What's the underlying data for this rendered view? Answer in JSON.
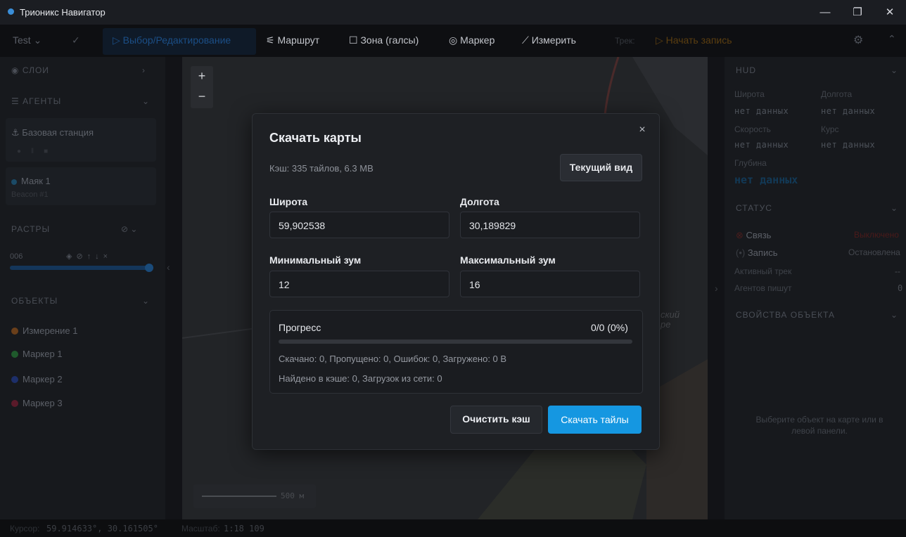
{
  "window": {
    "title": "Трионикс Навигатор",
    "minimize": "—",
    "restore": "❐",
    "close": "✕"
  },
  "toolbar": {
    "project": "Test",
    "mode_select": "Выбор/Редактирование",
    "route": "Маршрут",
    "zone": "Зона (галсы)",
    "marker": "Маркер",
    "measure": "Измерить",
    "track": "Трек:",
    "start_record": "Начать запись"
  },
  "left_panel": {
    "layers": "СЛОИ",
    "agents": "АГЕНТЫ",
    "base_station": "Базовая станция",
    "beacon_name": "Маяк 1",
    "beacon_sub": "Beacon #1",
    "rasters": "РАСТРЫ",
    "raster_item": "006",
    "objects": "ОБЪЕКТЫ",
    "object_items": [
      {
        "label": "Измерение 1",
        "color": "#6a3f1a"
      },
      {
        "label": "Маркер 1",
        "color": "#1f5a2c"
      },
      {
        "label": "Маркер 2",
        "color": "#1d2f6a"
      },
      {
        "label": "Маркер 3",
        "color": "#5a1a2a"
      }
    ]
  },
  "map": {
    "zoom_in": "+",
    "zoom_out": "−",
    "scale_label": "500 м",
    "place_text": "ский\nре"
  },
  "right_panel": {
    "hud": "HUD",
    "lat_label": "Широта",
    "lat_value": "нет данных",
    "lon_label": "Долгота",
    "lon_value": "нет данных",
    "speed_label": "Скорость",
    "speed_value": "нет данных",
    "course_label": "Курс",
    "course_value": "нет данных",
    "depth_label": "Глубина",
    "depth_value": "нет данных",
    "status": "СТАТУС",
    "link_label": "Связь",
    "link_value": "Выключено",
    "rec_label": "Запись",
    "rec_value": "Остановлена",
    "active_track_label": "Активный трек",
    "active_track_value": "--",
    "agents_writing_label": "Агентов пишут",
    "agents_writing_value": "0",
    "obj_props": "СВОЙСТВА ОБЪЕКТА",
    "obj_hint": "Выберите объект на карте или в левой панели."
  },
  "statusbar": {
    "cursor_label": "Курсор:",
    "cursor_value": "59.914633°, 30.161505°",
    "scale_label": "Масштаб:",
    "scale_value": "1:18 109"
  },
  "modal": {
    "title": "Скачать карты",
    "cache_info": "Кэш: 335 тайлов, 6.3 MB",
    "current_view": "Текущий вид",
    "lat_label": "Широта",
    "lat_value": "59,902538",
    "lon_label": "Долгота",
    "lon_value": "30,189829",
    "min_zoom_label": "Минимальный зум",
    "min_zoom_value": "12",
    "max_zoom_label": "Максимальный зум",
    "max_zoom_value": "16",
    "progress_label": "Прогресс",
    "progress_value": "0/0 (0%)",
    "progress_fraction": 0,
    "stats_line": "Скачано: 0, Пропущено: 0, Ошибок: 0, Загружено: 0 B",
    "cache_line": "Найдено в кэше: 0, Загрузок из сети: 0",
    "clear_cache": "Очистить кэш",
    "download": "Скачать тайлы",
    "close": "×"
  }
}
